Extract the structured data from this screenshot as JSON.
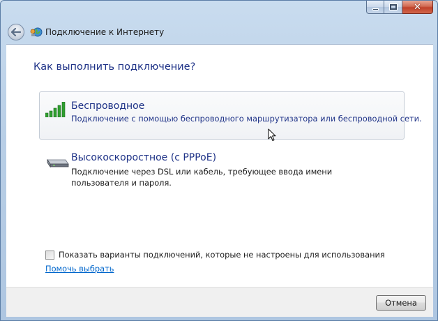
{
  "window": {
    "title": "Подключение к Интернету",
    "caption_buttons": {
      "minimize_icon": "minimize-icon",
      "maximize_icon": "maximize-icon",
      "close_symbol": "✕"
    }
  },
  "main": {
    "heading": "Как выполнить подключение?",
    "options": [
      {
        "title": "Беспроводное",
        "description": "Подключение с помощью беспроводного маршрутизатора или беспроводной сети.",
        "icon": "wireless-signal-icon",
        "state": "hover"
      },
      {
        "title": "Высокоскоростное (с PPPoE)",
        "description": "Подключение через DSL или кабель, требующее ввода имени пользователя и пароля.",
        "icon": "broadband-modem-icon",
        "state": "normal"
      }
    ],
    "show_unconfigured_checkbox": {
      "label": "Показать варианты подключений, которые не настроены для использования",
      "checked": false
    },
    "help_link": "Помочь выбрать"
  },
  "footer": {
    "cancel_label": "Отмена"
  },
  "colors": {
    "heading_blue": "#1e3287",
    "link_blue": "#0066cc",
    "signal_green": "#2f9e2f"
  }
}
